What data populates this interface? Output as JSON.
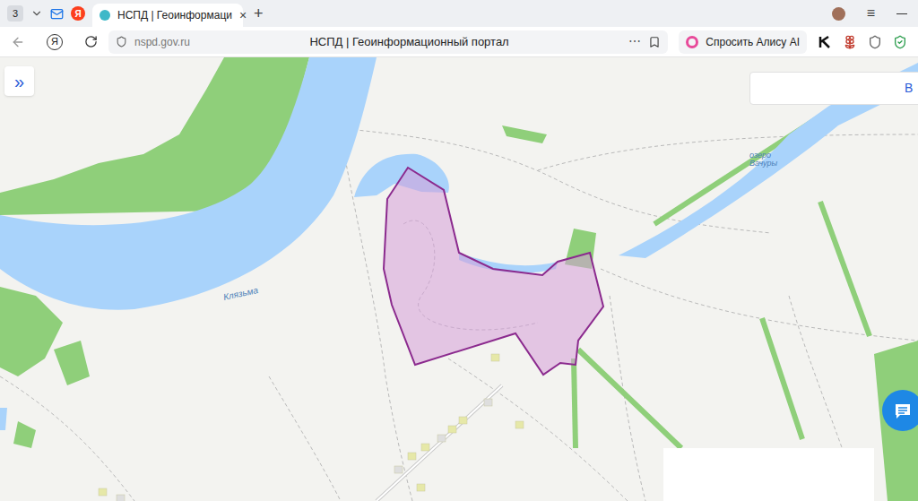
{
  "browser": {
    "tab_count": "3",
    "yandex_logo": "Я",
    "tabs": [
      {
        "title": "НСПД | Геоинформаци",
        "close": "×",
        "selected": true
      }
    ],
    "new_tab": "+",
    "menu": "≡"
  },
  "address_bar": {
    "url": "nspd.gov.ru",
    "page_title": "НСПД | Геоинформационный портал",
    "more": "⋯",
    "alice_button": "Спросить Алису AI"
  },
  "map": {
    "expand_button": "»",
    "search_text": "В",
    "labels": [
      {
        "lines": [
          "Клязьма"
        ],
        "kind": "river"
      },
      {
        "lines": [
          "озеро",
          "Вачуры"
        ],
        "kind": "lake"
      }
    ]
  }
}
